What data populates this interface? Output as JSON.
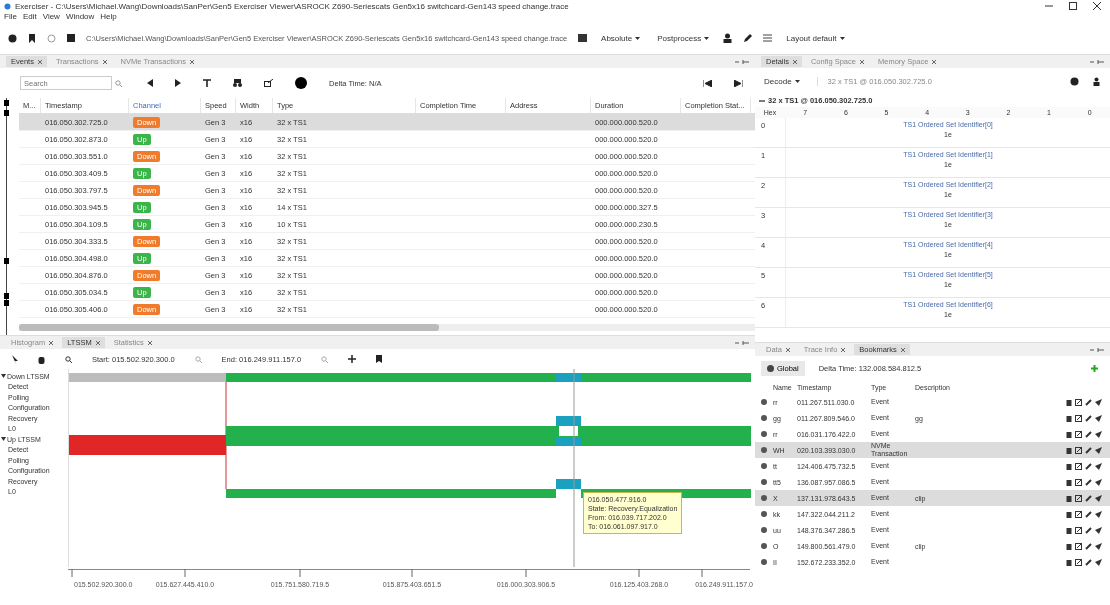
{
  "window": {
    "title": "Exerciser - C:\\Users\\Michael.Wang\\Downloads\\SanPer\\Gen5 Exerciser Viewer\\ASROCK Z690-Seriescats Gen5x16 switchcard-Gen143 speed change.trace",
    "menu": [
      "File",
      "Edit",
      "View",
      "Window",
      "Help"
    ]
  },
  "toolbar": {
    "path": "C:\\Users\\Michael.Wang\\Downloads\\SanPer\\Gen5 Exerciser Viewer\\ASROCK Z690-Seriescats Gen5x16 switchcard-Gen143 speed change.trace",
    "time_mode": "Absolute",
    "process": "Postprocess",
    "layout": "Layout default"
  },
  "events_panel": {
    "tabs": [
      {
        "label": "Events",
        "selected": true
      },
      {
        "label": "Transactions",
        "selected": false
      },
      {
        "label": "NVMe Transactions",
        "selected": false
      }
    ],
    "search": {
      "placeholder": "Search"
    },
    "delta_time": "Delta Time: N/A",
    "columns": [
      "M...",
      "Timestamp",
      "Channel",
      "Speed",
      "Width",
      "Type",
      "Completion Time",
      "Address",
      "Duration",
      "Completion Stat..."
    ],
    "rows": [
      {
        "timestamp": "016.050.302.725.0",
        "channel": {
          "label": "Down",
          "color": "#f07b2a"
        },
        "speed": "Gen 3",
        "width": "x16",
        "type": "32 x TS1",
        "duration": "000.000.000.520.0",
        "selected": true
      },
      {
        "timestamp": "016.050.302.873.0",
        "channel": {
          "label": "Up",
          "color": "#3bb54a"
        },
        "speed": "Gen 3",
        "width": "x16",
        "type": "32 x TS1",
        "duration": "000.000.000.520.0",
        "selected": false
      },
      {
        "timestamp": "016.050.303.551.0",
        "channel": {
          "label": "Down",
          "color": "#f07b2a"
        },
        "speed": "Gen 3",
        "width": "x16",
        "type": "32 x TS1",
        "duration": "000.000.000.520.0",
        "selected": false
      },
      {
        "timestamp": "016.050.303.409.5",
        "channel": {
          "label": "Up",
          "color": "#3bb54a"
        },
        "speed": "Gen 3",
        "width": "x16",
        "type": "32 x TS1",
        "duration": "000.000.000.520.0",
        "selected": false
      },
      {
        "timestamp": "016.050.303.797.5",
        "channel": {
          "label": "Down",
          "color": "#f07b2a"
        },
        "speed": "Gen 3",
        "width": "x16",
        "type": "32 x TS1",
        "duration": "000.000.000.520.0",
        "selected": false
      },
      {
        "timestamp": "016.050.303.945.5",
        "channel": {
          "label": "Up",
          "color": "#3bb54a"
        },
        "speed": "Gen 3",
        "width": "x16",
        "type": "14 x TS1",
        "duration": "000.000.000.327.5",
        "selected": false
      },
      {
        "timestamp": "016.050.304.109.5",
        "channel": {
          "label": "Up",
          "color": "#3bb54a"
        },
        "speed": "Gen 3",
        "width": "x16",
        "type": "10 x TS1",
        "duration": "000.000.000.230.5",
        "selected": false
      },
      {
        "timestamp": "016.050.304.333.5",
        "channel": {
          "label": "Down",
          "color": "#f07b2a"
        },
        "speed": "Gen 3",
        "width": "x16",
        "type": "32 x TS1",
        "duration": "000.000.000.520.0",
        "selected": false
      },
      {
        "timestamp": "016.050.304.498.0",
        "channel": {
          "label": "Up",
          "color": "#3bb54a"
        },
        "speed": "Gen 3",
        "width": "x16",
        "type": "32 x TS1",
        "duration": "000.000.000.520.0",
        "selected": false
      },
      {
        "timestamp": "016.050.304.876.0",
        "channel": {
          "label": "Down",
          "color": "#f07b2a"
        },
        "speed": "Gen 3",
        "width": "x16",
        "type": "32 x TS1",
        "duration": "000.000.000.520.0",
        "selected": false
      },
      {
        "timestamp": "016.050.305.034.5",
        "channel": {
          "label": "Up",
          "color": "#3bb54a"
        },
        "speed": "Gen 3",
        "width": "x16",
        "type": "32 x TS1",
        "duration": "000.000.000.520.0",
        "selected": false
      },
      {
        "timestamp": "016.050.305.406.0",
        "channel": {
          "label": "Down",
          "color": "#f07b2a"
        },
        "speed": "Gen 3",
        "width": "x16",
        "type": "32 x TS1",
        "duration": "000.000.000.520.0",
        "selected": false
      }
    ]
  },
  "ltssm_panel": {
    "tabs": [
      {
        "label": "Histogram",
        "selected": false
      },
      {
        "label": "LTSSM",
        "selected": true
      },
      {
        "label": "Statistics",
        "selected": false
      }
    ],
    "start": "Start: 015.502.920.300.0",
    "end": "End: 016.249.911.157.0",
    "tree": [
      {
        "label": "Down LTSSM",
        "expanded": true,
        "children": [
          {
            "label": "Detect"
          },
          {
            "label": "Polling"
          },
          {
            "label": "Configuration"
          },
          {
            "label": "Recovery"
          },
          {
            "label": "L0"
          }
        ]
      },
      {
        "label": "Up LTSSM",
        "expanded": true,
        "children": [
          {
            "label": "Detect"
          },
          {
            "label": "Polling"
          },
          {
            "label": "Configuration"
          },
          {
            "label": "Recovery"
          },
          {
            "label": "L0"
          }
        ]
      }
    ],
    "tooltip": [
      "016.050.477.916.0",
      "State: Recovery.Equalization",
      "From: 016.039.717.202.0",
      "To: 016.061.097.917.0"
    ],
    "axis_labels": [
      "015.502.920.300.0",
      "015.627.445.410.0",
      "015.751.580.719.5",
      "015.875.403.651.5",
      "016.000.303.906.5",
      "016.125.403.268.0",
      "016.249.911.157.0"
    ]
  },
  "details_panel": {
    "tabs": [
      {
        "label": "Details",
        "selected": true
      },
      {
        "label": "Config Space",
        "selected": false
      },
      {
        "label": "Memory Space",
        "selected": false
      }
    ],
    "decode": "Decode",
    "query": "32 x TS1 @ 016.050.302.725.0",
    "tree_title": "32 x TS1 @ 016.050.302.725.0",
    "expanded": true,
    "columns": [
      "Hex",
      "7",
      "6",
      "5",
      "4",
      "3",
      "2",
      "1",
      "0"
    ],
    "rows": [
      {
        "index": "0",
        "name": "TS1 Ordered Set Identifier[0]",
        "value": "1e"
      },
      {
        "index": "1",
        "name": "TS1 Ordered Set Identifier[1]",
        "value": "1e"
      },
      {
        "index": "2",
        "name": "TS1 Ordered Set Identifier[2]",
        "value": "1e"
      },
      {
        "index": "3",
        "name": "TS1 Ordered Set Identifier[3]",
        "value": "1e"
      },
      {
        "index": "4",
        "name": "TS1 Ordered Set Identifier[4]",
        "value": "1e"
      },
      {
        "index": "5",
        "name": "TS1 Ordered Set Identifier[5]",
        "value": "1e"
      },
      {
        "index": "6",
        "name": "TS1 Ordered Set Identifier[6]",
        "value": "1e"
      }
    ]
  },
  "bookmarks_panel": {
    "tabs": [
      {
        "label": "Data",
        "selected": false
      },
      {
        "label": "Trace Info",
        "selected": false
      },
      {
        "label": "Bookmarks",
        "selected": true
      }
    ],
    "scope": "Global",
    "delta_time": "Delta Time: 132.008.584.812.5",
    "columns": [
      "Name",
      "Timestamp",
      "Type",
      "Description"
    ],
    "rows": [
      {
        "name": "rr",
        "timestamp": "011.267.511.030.0",
        "type": "Event",
        "description": "",
        "selected": false
      },
      {
        "name": "gg",
        "timestamp": "011.267.809.546.0",
        "type": "Event",
        "description": "gg",
        "selected": false
      },
      {
        "name": "rr",
        "timestamp": "016.031.176.422.0",
        "type": "Event",
        "description": "",
        "selected": false
      },
      {
        "name": "WH",
        "timestamp": "020.103.393.030.0",
        "type": "NVMe Transaction",
        "description": "",
        "selected": true
      },
      {
        "name": "tt",
        "timestamp": "124.406.475.732.5",
        "type": "Event",
        "description": "",
        "selected": false
      },
      {
        "name": "tt5",
        "timestamp": "136.087.957.086.5",
        "type": "Event",
        "description": "",
        "selected": false
      },
      {
        "name": "X",
        "timestamp": "137.131.978.643.5",
        "type": "Event",
        "description": "clip",
        "selected": true
      },
      {
        "name": "kk",
        "timestamp": "147.322.044.211.2",
        "type": "Event",
        "description": "",
        "selected": false
      },
      {
        "name": "uu",
        "timestamp": "148.376.347.286.5",
        "type": "Event",
        "description": "",
        "selected": false
      },
      {
        "name": "O",
        "timestamp": "149.800.561.479.0",
        "type": "Event",
        "description": "clip",
        "selected": false
      },
      {
        "name": "II",
        "timestamp": "152.672.233.352.0",
        "type": "Event",
        "description": "",
        "selected": false
      }
    ]
  }
}
